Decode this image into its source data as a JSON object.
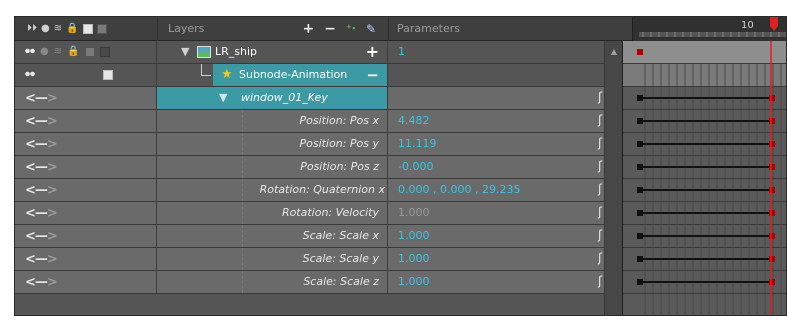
{
  "header": {
    "layers_label": "Layers",
    "parameters_label": "Parameters",
    "frame_number": "10",
    "tool_add": "+",
    "tool_remove": "−",
    "tool_add_peg": "⁺⋅",
    "tool_effect": "⚙"
  },
  "rows": [
    {
      "layer": "LR_ship",
      "value": "1",
      "add": "+"
    },
    {
      "layer": "Subnode-Animation",
      "value": "",
      "remove": "−"
    },
    {
      "layer": "window_01_Key",
      "value": ""
    },
    {
      "layer": "Position: Pos x",
      "value": "4.482"
    },
    {
      "layer": "Position: Pos y",
      "value": "11.119"
    },
    {
      "layer": "Position: Pos z",
      "value": "-0.000"
    },
    {
      "layer": "Rotation: Quaternion x",
      "value": "0.000 , 0.000 , 29.235"
    },
    {
      "layer": "Rotation: Velocity",
      "value": "1.000"
    },
    {
      "layer": "Scale: Scale x",
      "value": "1.000"
    },
    {
      "layer": "Scale: Scale y",
      "value": "1.000"
    },
    {
      "layer": "Scale: Scale z",
      "value": "1.000"
    }
  ],
  "colors": {
    "selection": "#3c9aa5",
    "value_text": "#39c6e6",
    "playhead": "#e02020",
    "keyframe_start": "#b00000"
  }
}
